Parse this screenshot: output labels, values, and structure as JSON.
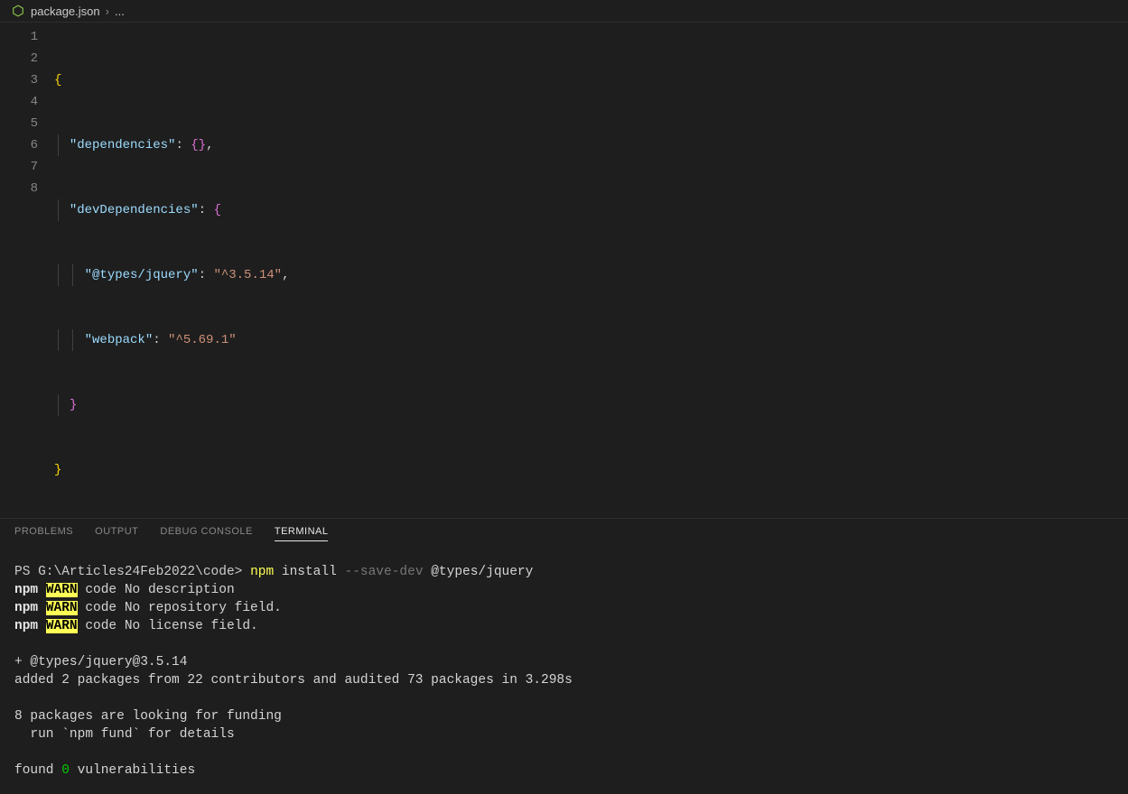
{
  "breadcrumb": {
    "filename": "package.json",
    "separator": "›",
    "extra": "..."
  },
  "code": {
    "lines": [
      "1",
      "2",
      "3",
      "4",
      "5",
      "6",
      "7",
      "8"
    ],
    "l1_brace": "{",
    "l2_key": "\"dependencies\"",
    "l2_colon": ": ",
    "l2_empty": "{}",
    "l2_comma": ",",
    "l3_key": "\"devDependencies\"",
    "l3_colon": ": ",
    "l3_brace": "{",
    "l4_key": "\"@types/jquery\"",
    "l4_colon": ": ",
    "l4_val": "\"^3.5.14\"",
    "l4_comma": ",",
    "l5_key": "\"webpack\"",
    "l5_colon": ": ",
    "l5_val": "\"^5.69.1\"",
    "l6_brace": "}",
    "l7_brace": "}"
  },
  "panel": {
    "problems": "PROBLEMS",
    "output": "OUTPUT",
    "debug": "DEBUG CONSOLE",
    "terminal": "TERMINAL"
  },
  "terminal": {
    "prompt_ps": "PS ",
    "prompt_path": "G:\\Articles24Feb2022\\code> ",
    "cmd_npm": "npm",
    "cmd_install": " install ",
    "cmd_savedev": "--save-dev",
    "cmd_package": " @types/jquery",
    "warn_npm": "npm",
    "warn_tag": "WARN",
    "warn1": " code No description",
    "warn2": " code No repository field.",
    "warn3": " code No license field.",
    "plus_line": "+ @types/jquery@3.5.14",
    "added_line": "added 2 packages from 22 contributors and audited 73 packages in 3.298s",
    "funding1": "8 packages are looking for funding",
    "funding2": "  run `npm fund` for details",
    "found_prefix": "found ",
    "found_zero": "0",
    "found_suffix": " vulnerabilities"
  }
}
